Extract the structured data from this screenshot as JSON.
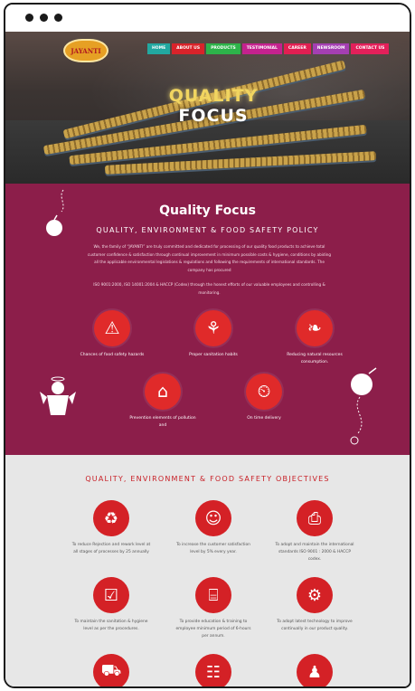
{
  "hero": {
    "logo_text": "JAYANTI",
    "title_line1": "QUALITY",
    "title_line2": "FOCUS",
    "nav": [
      {
        "label": "HOME",
        "color": "#22a8a0"
      },
      {
        "label": "ABOUT US",
        "color": "#d8232a"
      },
      {
        "label": "PRODUCTS",
        "color": "#2db34a"
      },
      {
        "label": "TESTIMONIAL",
        "color": "#c4228e"
      },
      {
        "label": "CAREER",
        "color": "#e11f52"
      },
      {
        "label": "NEWSROOM",
        "color": "#a43fb2"
      },
      {
        "label": "CONTACT US",
        "color": "#e3205a"
      }
    ]
  },
  "quality": {
    "title": "Quality Focus",
    "subtitle": "QUALITY, ENVIRONMENT & FOOD SAFETY POLICY",
    "paragraph1": "We, the family of “JAYANTI” are truly committed and dedicated for processing of our quality food products to achieve total customer confidence & satisfaction through continual improvement in minimum possible costs & hygiene, conditions by abiding all the applicable environmental legislations & regulations and following the requirements of international standards. The company has procured",
    "paragraph2": "ISO 9001:2000, ISO 14001:2004 & HACCP (Codex) through the honest efforts of our valuable employees and controlling & monitoring.",
    "features": [
      {
        "icon": "warning-icon",
        "glyph": "⚠",
        "label": "Chances of food safety hazards"
      },
      {
        "icon": "hand-washing-icon",
        "glyph": "⚘",
        "label": "Proper sanitation habits"
      },
      {
        "icon": "leaf-icon",
        "glyph": "❧",
        "label": "Reducing natural resources consumption."
      },
      {
        "icon": "factory-icon",
        "glyph": "⌂",
        "label": "Prevention elements of pollution and"
      },
      {
        "icon": "clock-icon",
        "glyph": "⏲",
        "label": "On time delivery"
      }
    ]
  },
  "objectives": {
    "title": "QUALITY, ENVIRONMENT & FOOD SAFETY OBJECTIVES",
    "items": [
      {
        "icon": "recycle-icon",
        "glyph": "♻",
        "label": "To reduce Rejection and rework level at all stages of processes by 25 annually"
      },
      {
        "icon": "customer-icon",
        "glyph": "☺",
        "label": "To increase the customer satisfaction level by 5% every year."
      },
      {
        "icon": "iso-icon",
        "glyph": "⎙",
        "label": "To adopt and maintain the international standards ISO 9001 : 2000 & HACCP codex."
      },
      {
        "icon": "checklist-icon",
        "glyph": "☑",
        "label": "To maintain the sanitation & hygiene level as per the procedures."
      },
      {
        "icon": "book-icon",
        "glyph": "⌸",
        "label": "To provide education & training to employee minimum period of 6-hours per annum."
      },
      {
        "icon": "gear-icon",
        "glyph": "⚙",
        "label": "To adopt latest technology to improve continually in our product quality."
      },
      {
        "icon": "truck-icon",
        "glyph": "⛟",
        "label": ""
      },
      {
        "icon": "meeting-icon",
        "glyph": "☷",
        "label": ""
      },
      {
        "icon": "team-icon",
        "glyph": "♟",
        "label": ""
      }
    ]
  },
  "colors": {
    "maroon": "#8c1e4a",
    "red": "#d42126",
    "objectives_bg": "#e7e7e7"
  }
}
